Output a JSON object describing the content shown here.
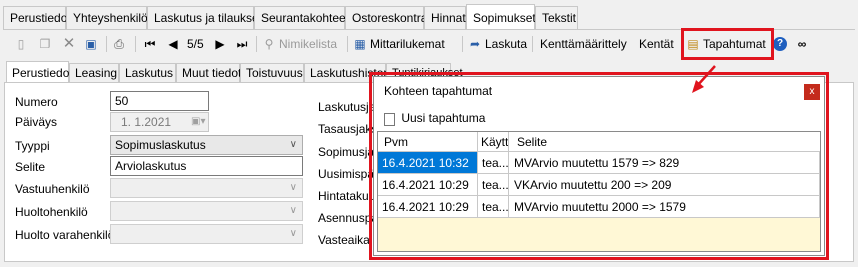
{
  "top_tabs": [
    "Perustiedot",
    "Yhteyshenkilöt",
    "Laskutus ja tilaukset",
    "Seurantakohteet",
    "Ostoreskontra",
    "Hinnat",
    "Sopimukset",
    "Tekstit"
  ],
  "toolbar": {
    "page": "5/5",
    "nimikelista": "Nimikelista",
    "mittarilukemat": "Mittarilukemat",
    "laskuta": "Laskuta",
    "kenttamaarittely": "Kenttämäärittely",
    "kentat": "Kentät",
    "tapahtumat": "Tapahtumat"
  },
  "sub_tabs": [
    "Perustiedot",
    "Leasing",
    "Laskutus",
    "Muut tiedot",
    "Toistuvuus",
    "Laskutushistoria",
    "Tuntikirjaukset"
  ],
  "form": {
    "numero_label": "Numero",
    "numero_value": "50",
    "paivays_label": "Päiväys",
    "paivays_value": "1.  1.2021",
    "tyyppi_label": "Tyyppi",
    "tyyppi_value": "Sopimuslaskutus",
    "selite_label": "Selite",
    "selite_value": "Arviolaskutus",
    "vastuuhenkilo_label": "Vastuuhenkilö",
    "huoltohenkilo_label": "Huoltohenkilö",
    "huolto_varahenkilo_label": "Huolto varahenkilö"
  },
  "right_labels": [
    "Laskutusjakso",
    "Tasausjakso",
    "Sopimusjakso",
    "Uusimispäivä",
    "Hintatakuu",
    "Asennuspäivä",
    "Vasteaika"
  ],
  "dialog": {
    "title": "Kohteen tapahtumat",
    "close": "x",
    "new_button": "Uusi tapahtuma",
    "columns": [
      "Pvm",
      "Käytt",
      "Selite"
    ],
    "rows": [
      {
        "pvm": "16.4.2021 10:32",
        "user": "tea...",
        "selite": "MVArvio muutettu 1579 => 829"
      },
      {
        "pvm": "16.4.2021 10:29",
        "user": "tea...",
        "selite": "VKArvio muutettu 200 => 209"
      },
      {
        "pvm": "16.4.2021 10:29",
        "user": "tea...",
        "selite": "MVArvio muutettu 2000 => 1579"
      }
    ]
  },
  "colors": {
    "highlight": "#e0141e",
    "selection": "#0078d7",
    "grid_fill": "#fff8d6"
  }
}
